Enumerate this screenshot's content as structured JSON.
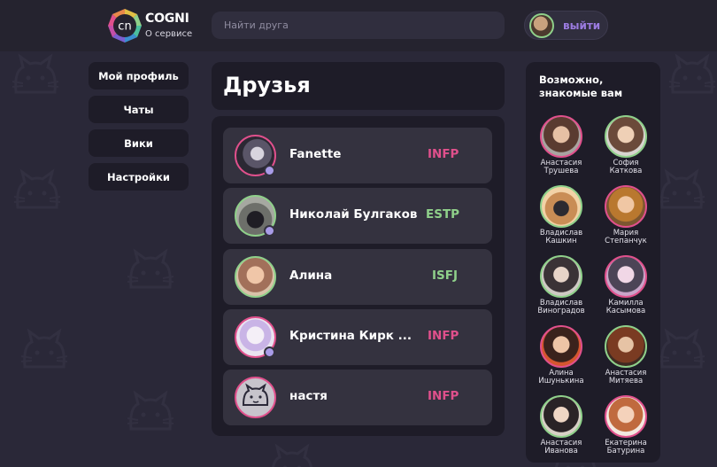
{
  "colors": {
    "page_bg": "#2a2838",
    "panel_bg": "#1e1c28",
    "row_bg": "#34323f",
    "accent_pink": "#e0508c",
    "accent_green": "#8fd08a",
    "accent_purple": "#9b7be0"
  },
  "header": {
    "brand_mark": "cn",
    "brand_name": "COGNI",
    "about_link": "О сервисе",
    "search_placeholder": "Найти друга",
    "logout_label": "выйти"
  },
  "nav": {
    "items": [
      {
        "label": "Мой профиль"
      },
      {
        "label": "Чаты"
      },
      {
        "label": "Вики"
      },
      {
        "label": "Настройки"
      }
    ]
  },
  "friends": {
    "title": "Друзья",
    "list": [
      {
        "name": "Fanette",
        "type": "INFP",
        "type_color": "#e0508c",
        "ring_color": "#e0508c",
        "online": true
      },
      {
        "name": "Николай Булгаков",
        "type": "ESTP",
        "type_color": "#8fd08a",
        "ring_color": "#8fd08a",
        "online": true
      },
      {
        "name": "Алина",
        "type": "ISFJ",
        "type_color": "#8fd08a",
        "ring_color": "#8fd08a",
        "online": false
      },
      {
        "name": "Кристина Кирк ...",
        "type": "INFP",
        "type_color": "#e0508c",
        "ring_color": "#e0508c",
        "online": true
      },
      {
        "name": "настя",
        "type": "INFP",
        "type_color": "#e0508c",
        "ring_color": "#e0508c",
        "online": false
      }
    ]
  },
  "suggestions": {
    "title": "Возможно, знакомые вам",
    "people": [
      {
        "first": "Анастасия",
        "last": "Трушева",
        "ring_color": "#e0508c"
      },
      {
        "first": "София",
        "last": "Каткова",
        "ring_color": "#8fd08a"
      },
      {
        "first": "Владислав",
        "last": "Кашкин",
        "ring_color": "#8fd08a"
      },
      {
        "first": "Мария",
        "last": "Степанчук",
        "ring_color": "#e0508c"
      },
      {
        "first": "Владислав",
        "last": "Виноградов",
        "ring_color": "#8fd08a"
      },
      {
        "first": "Камилла",
        "last": "Касымова",
        "ring_color": "#e0508c"
      },
      {
        "first": "Алина",
        "last": "Ишунькина",
        "ring_color": "#e0508c"
      },
      {
        "first": "Анастасия",
        "last": "Митяева",
        "ring_color": "#8fd08a"
      },
      {
        "first": "Анастасия",
        "last": "Иванова",
        "ring_color": "#8fd08a"
      },
      {
        "first": "Екатерина",
        "last": "Батурина",
        "ring_color": "#e0508c"
      }
    ]
  }
}
